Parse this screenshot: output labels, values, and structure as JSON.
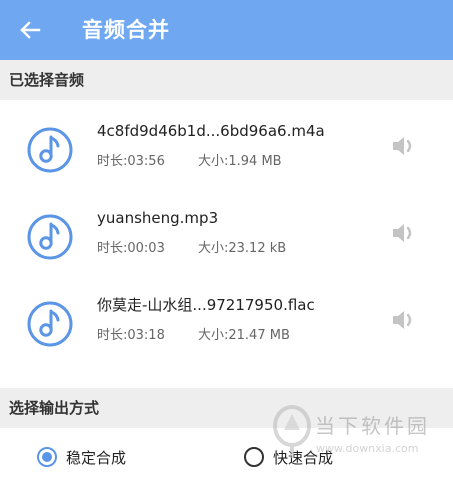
{
  "header": {
    "title": "音频合并",
    "back_icon": "arrow-left-icon"
  },
  "selected_section": {
    "title": "已选择音频"
  },
  "files": [
    {
      "name": "4c8fd9d46b1d...6bd96a6.m4a",
      "duration": "时长:03:56",
      "size": "大小:1.94 MB"
    },
    {
      "name": "yuansheng.mp3",
      "duration": "时长:00:03",
      "size": "大小:23.12 kB"
    },
    {
      "name": "你莫走-山水组...97217950.flac",
      "duration": "时长:03:18",
      "size": "大小:21.47 MB"
    }
  ],
  "output_section": {
    "title": "选择输出方式"
  },
  "output_options": [
    {
      "label": "稳定合成",
      "selected": true
    },
    {
      "label": "快速合成",
      "selected": false
    }
  ],
  "watermark": {
    "text_cn": "当下软件园",
    "url": "www.downxia.com"
  },
  "colors": {
    "accent": "#6fa8f1",
    "icon_blue": "#5b95e6",
    "header_bg": "#eeeeee"
  }
}
